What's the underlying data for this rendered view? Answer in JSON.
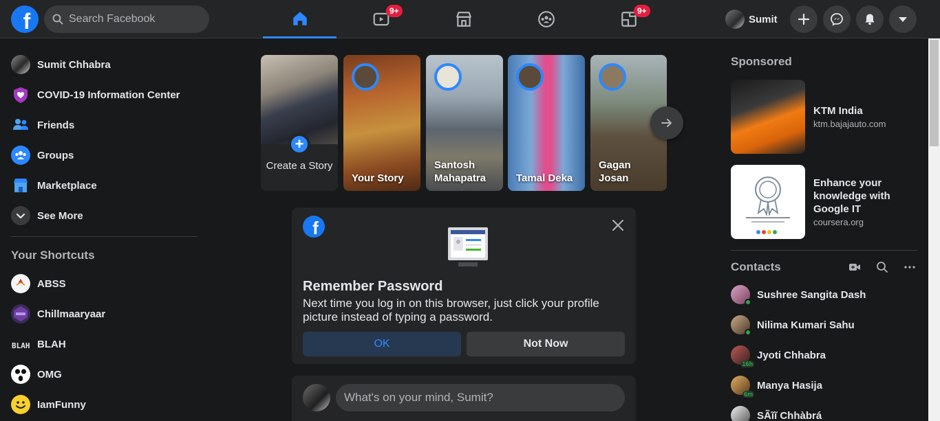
{
  "topbar": {
    "search_placeholder": "Search Facebook",
    "video_badge": "9+",
    "gaming_badge": "9+",
    "profile_name": "Sumit"
  },
  "sidebar": {
    "items": [
      {
        "label": "Sumit Chhabra",
        "icon": "user-avatar"
      },
      {
        "label": "COVID-19 Information Center",
        "icon": "covid-heart-icon"
      },
      {
        "label": "Friends",
        "icon": "friends-icon"
      },
      {
        "label": "Groups",
        "icon": "groups-icon"
      },
      {
        "label": "Marketplace",
        "icon": "marketplace-icon"
      },
      {
        "label": "See More",
        "icon": "chevron-down-icon"
      }
    ],
    "shortcuts_title": "Your Shortcuts",
    "shortcuts": [
      {
        "label": "ABSS"
      },
      {
        "label": "Chillmaaryaar"
      },
      {
        "label": "BLAH"
      },
      {
        "label": "OMG"
      },
      {
        "label": "IamFunny"
      }
    ]
  },
  "stories": {
    "create_label": "Create a Story",
    "items": [
      {
        "name": "Your Story"
      },
      {
        "name": "Santosh Mahapatra"
      },
      {
        "name": "Tamal Deka"
      },
      {
        "name": "Gagan Josan"
      }
    ]
  },
  "remember_password": {
    "title": "Remember Password",
    "body": "Next time you log in on this browser, just click your profile picture instead of typing a password.",
    "ok_label": "OK",
    "not_now_label": "Not Now"
  },
  "composer": {
    "placeholder": "What's on your mind, Sumit?"
  },
  "right": {
    "sponsored_title": "Sponsored",
    "ads": [
      {
        "title": "KTM India",
        "domain": "ktm.bajajauto.com"
      },
      {
        "title": "Enhance your knowledge with Google IT",
        "domain": "coursera.org"
      }
    ],
    "contacts_title": "Contacts",
    "contacts": [
      {
        "name": "Sushree Sangita Dash",
        "status": "online",
        "time": ""
      },
      {
        "name": "Nilima Kumari Sahu",
        "status": "online",
        "time": ""
      },
      {
        "name": "Jyoti Chhabra",
        "status": "away",
        "time": "16h"
      },
      {
        "name": "Manya Hasija",
        "status": "away",
        "time": "6m"
      },
      {
        "name": "SÃĩĩ Chhàbrá",
        "status": "",
        "time": ""
      }
    ]
  },
  "colors": {
    "accent": "#2d88ff",
    "brand": "#1877f2",
    "badge": "#e41e3f",
    "online": "#31a24c"
  }
}
